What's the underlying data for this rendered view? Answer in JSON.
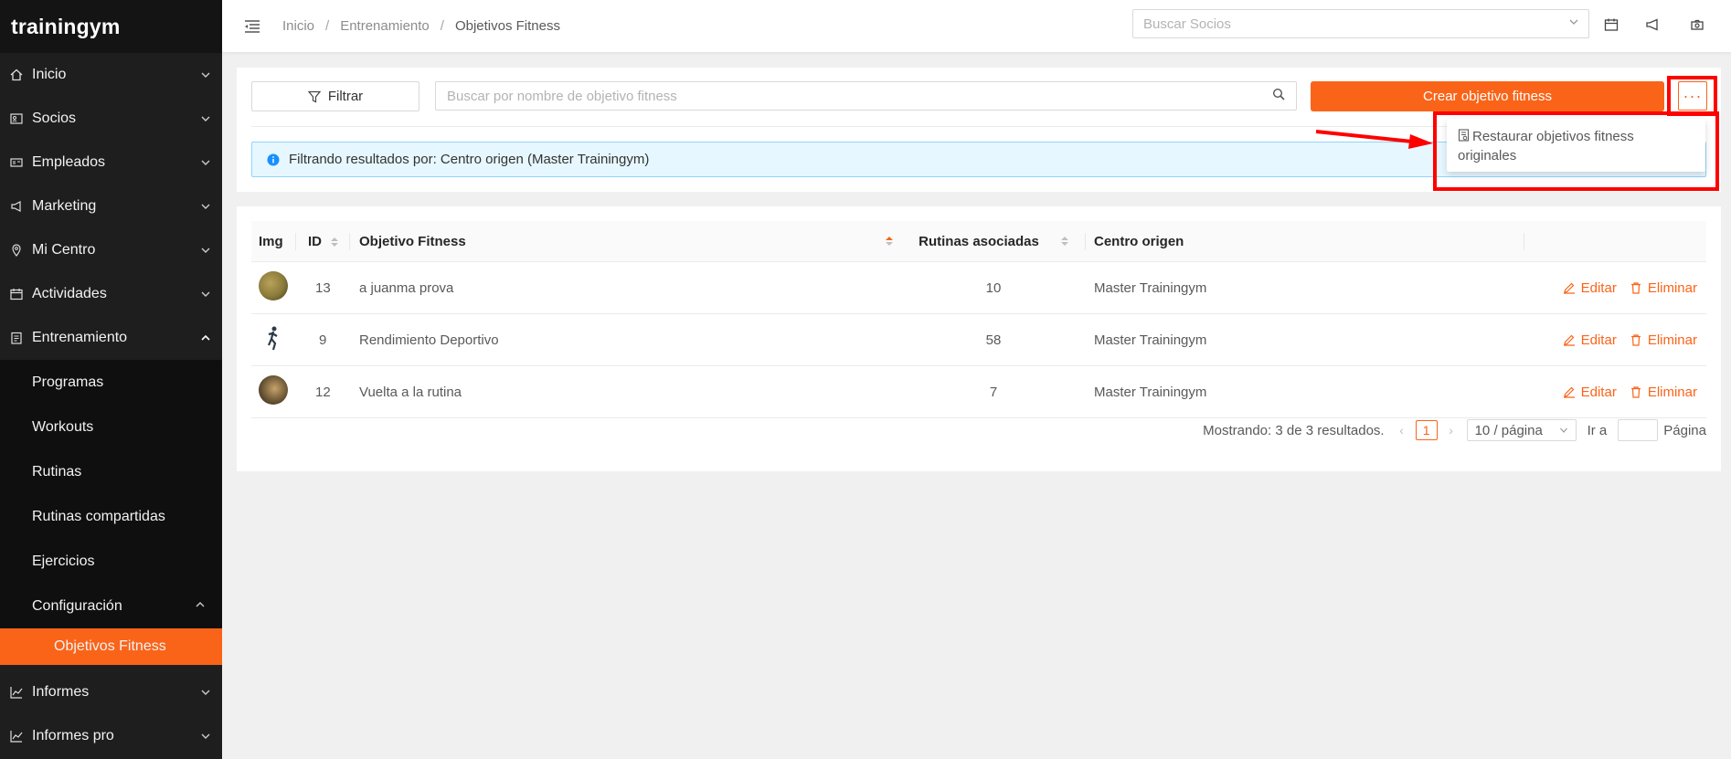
{
  "brand": "trainingym",
  "sidebar": {
    "items": [
      {
        "label": "Inicio"
      },
      {
        "label": "Socios"
      },
      {
        "label": "Empleados"
      },
      {
        "label": "Marketing"
      },
      {
        "label": "Mi Centro"
      },
      {
        "label": "Actividades"
      },
      {
        "label": "Entrenamiento"
      }
    ],
    "sub_items": [
      {
        "label": "Programas"
      },
      {
        "label": "Workouts"
      },
      {
        "label": "Rutinas"
      },
      {
        "label": "Rutinas compartidas"
      },
      {
        "label": "Ejercicios"
      },
      {
        "label": "Configuración"
      }
    ],
    "active_item": "Objetivos Fitness",
    "bottom_items": [
      {
        "label": "Informes"
      },
      {
        "label": "Informes pro"
      }
    ]
  },
  "header": {
    "breadcrumb": [
      "Inicio",
      "Entrenamiento",
      "Objetivos Fitness"
    ],
    "member_search_placeholder": "Buscar Socios"
  },
  "toolbar": {
    "filter_label": "Filtrar",
    "search_placeholder": "Buscar por nombre de objetivo fitness",
    "create_label": "Crear objetivo fitness",
    "more_label": "···"
  },
  "dropdown": {
    "restore_label": "Restaurar objetivos fitness originales"
  },
  "alert": {
    "text": "Filtrando resultados por: Centro origen (Master Trainingym)"
  },
  "table": {
    "headers": {
      "img": "Img",
      "id": "ID",
      "goal": "Objetivo Fitness",
      "routines": "Rutinas asociadas",
      "center": "Centro origen"
    },
    "rows": [
      {
        "id": "13",
        "goal": "a juanma prova",
        "routines": "10",
        "center": "Master Trainingym",
        "avatar_color": "#8a7a3a"
      },
      {
        "id": "9",
        "goal": "Rendimiento Deportivo",
        "routines": "58",
        "center": "Master Trainingym",
        "avatar_color": "#2e3a4a"
      },
      {
        "id": "12",
        "goal": "Vuelta a la rutina",
        "routines": "7",
        "center": "Master Trainingym",
        "avatar_color": "#6b5636"
      }
    ],
    "edit_label": "Editar",
    "delete_label": "Eliminar"
  },
  "pagination": {
    "summary": "Mostrando: 3 de 3 resultados.",
    "current_page": "1",
    "page_size": "10 / página",
    "goto_label": "Ir a",
    "page_label": "Página"
  },
  "colors": {
    "accent": "#fa6419",
    "sidebar_bg": "#1e1e1e",
    "highlight": "#ff0000"
  }
}
